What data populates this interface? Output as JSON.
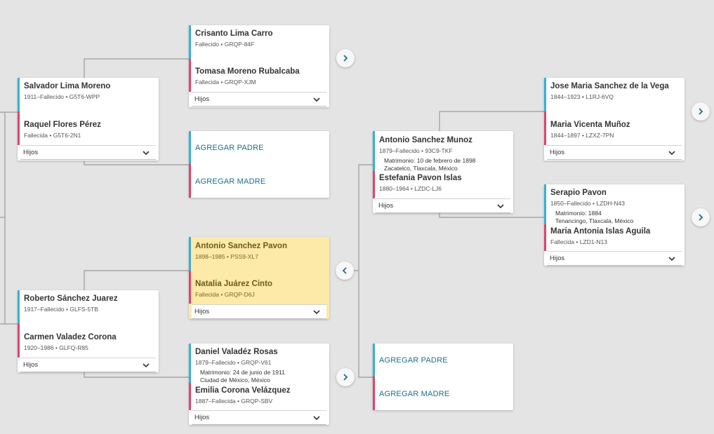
{
  "couples": [
    {
      "father": {
        "name": "Salvador Lima Moreno",
        "meta": "1911–Fallecido • G5T6-WPP"
      },
      "mother": {
        "name": "Raquel Flores Pérez",
        "meta": "Fallecida • G5T6-2N1"
      },
      "children_label": "Hijos"
    },
    {
      "father": {
        "name": "Roberto Sánchez Juarez",
        "meta": "1917–Fallecido • GLFS-5TB"
      },
      "mother": {
        "name": "Carmen Valadez Corona",
        "meta": "1920–1986 • GLFQ-R85"
      },
      "children_label": "Hijos"
    },
    {
      "father": {
        "name": "Crisanto Lima Carro",
        "meta": "Fallecido • GRQP-84F"
      },
      "mother": {
        "name": "Tomasa Moreno Rubalcaba",
        "meta": "Fallecida • GRQP-XJM"
      },
      "children_label": "Hijos"
    },
    {
      "add_father": "AGREGAR PADRE",
      "add_mother": "AGREGAR MADRE"
    },
    {
      "father": {
        "name": "Antonio Sanchez Pavon",
        "meta": "1898–1985 • PSS9-XL7"
      },
      "mother": {
        "name": "Natalia Juárez Cinto",
        "meta": "Fallecida • GRQP-D6J"
      },
      "children_label": "Hijos"
    },
    {
      "father": {
        "name": "Daniel Valadéz Rosas",
        "meta": "1879–Fallecido • GRQP-V61"
      },
      "marriage": {
        "line1": "Matrimonio: 24 de junio de 1911",
        "line2": "Ciudad de México, México"
      },
      "mother": {
        "name": "Emilia Corona Velázquez",
        "meta": "1887–Fallecida • GRQP-SBV"
      },
      "children_label": "Hijos"
    },
    {
      "father": {
        "name": "Antonio Sanchez Munoz",
        "meta": "1879–Fallecido • 93C9-TKF"
      },
      "marriage": {
        "line1": "Matrimonio: 10 de febrero de 1898",
        "line2": "Zacatelco, Tlaxcala, México"
      },
      "mother": {
        "name": "Estefania Pavon Islas",
        "meta": "1880–1964 • LZDC-LJ6"
      },
      "children_label": "Hijos"
    },
    {
      "add_father": "AGREGAR PADRE",
      "add_mother": "AGREGAR MADRE"
    },
    {
      "father": {
        "name": "Jose Maria Sanchez de la Vega",
        "meta": "1844–1923 • L1RJ-6VQ"
      },
      "mother": {
        "name": "Maria Vicenta Muñoz",
        "meta": "1844–1897 • LZXZ-7PN"
      },
      "children_label": "Hijos"
    },
    {
      "father": {
        "name": "Serapio Pavon",
        "meta": "1850–Fallecido • LZDH-N43"
      },
      "marriage": {
        "line1": "Matrimonio: 1884",
        "line2": "Tenancingo, Tlaxcala, México"
      },
      "mother": {
        "name": "Maria Antonia Islas Aguila",
        "meta": "Fallecida • LZD1-N13"
      },
      "children_label": "Hijos"
    }
  ],
  "icons": {
    "expand": "chevron-right-icon",
    "collapse": "chevron-left-icon",
    "dropdown": "chevron-down-icon"
  },
  "colors": {
    "father_accent": "#36b1d1",
    "mother_accent": "#e0446d",
    "focus_background": "#fde9a8",
    "link": "#1a6f8e"
  }
}
